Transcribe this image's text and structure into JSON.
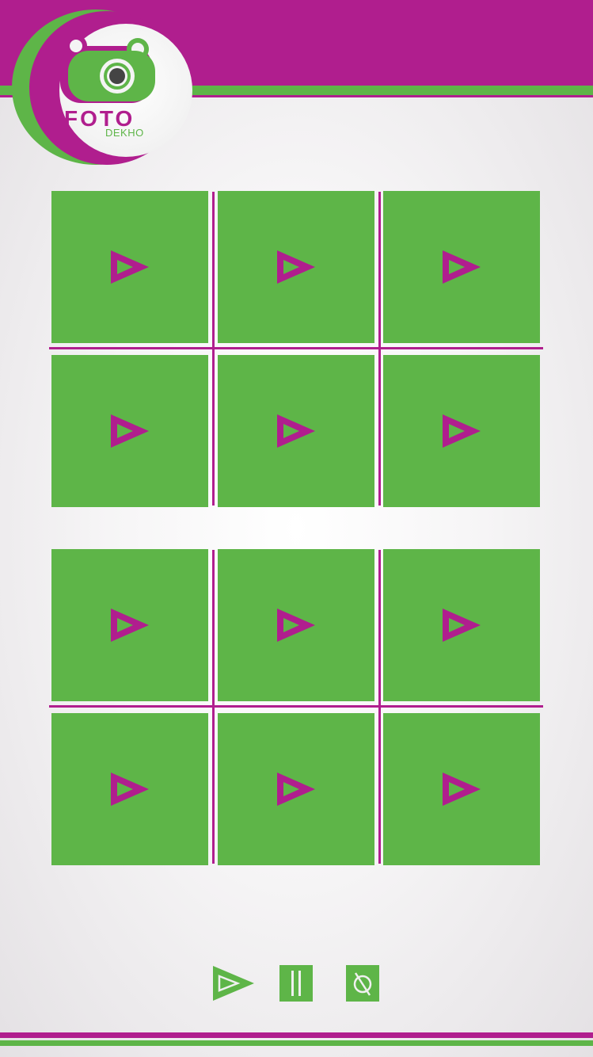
{
  "app": {
    "logo_word": "FOTO",
    "logo_sub": "DEKHO"
  },
  "colors": {
    "primary": "#b01e8e",
    "accent": "#5eb548",
    "background": "#f2f0f2"
  },
  "grids": [
    {
      "tiles": [
        {
          "icon": "play-icon"
        },
        {
          "icon": "play-icon"
        },
        {
          "icon": "play-icon"
        },
        {
          "icon": "play-icon"
        },
        {
          "icon": "play-icon"
        },
        {
          "icon": "play-icon"
        }
      ]
    },
    {
      "tiles": [
        {
          "icon": "play-icon"
        },
        {
          "icon": "play-icon"
        },
        {
          "icon": "play-icon"
        },
        {
          "icon": "play-icon"
        },
        {
          "icon": "play-icon"
        },
        {
          "icon": "play-icon"
        }
      ]
    }
  ],
  "controls": [
    {
      "name": "play",
      "icon": "play-icon"
    },
    {
      "name": "pause",
      "icon": "pause-icon"
    },
    {
      "name": "stop",
      "icon": "stop-icon"
    }
  ]
}
